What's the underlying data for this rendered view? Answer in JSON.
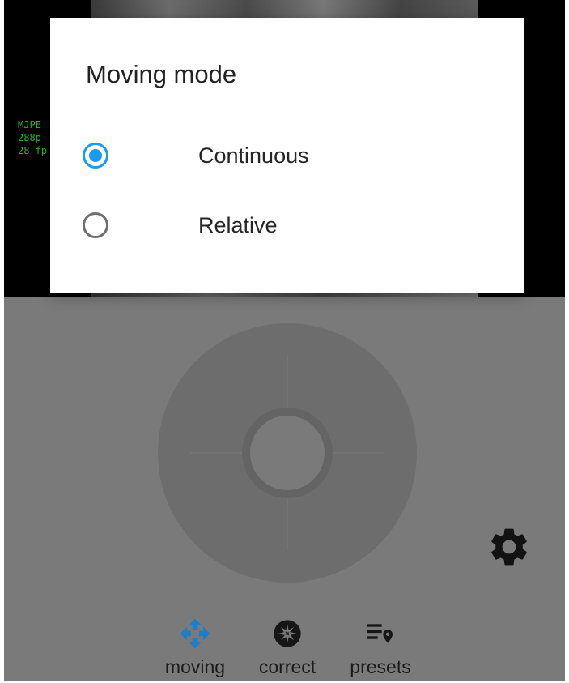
{
  "video_overlay": {
    "line1": "MJPE",
    "line2": "288p",
    "line3": "28 fp"
  },
  "dialog": {
    "title": "Moving mode",
    "options": [
      {
        "label": "Continuous",
        "selected": true
      },
      {
        "label": "Relative",
        "selected": false
      }
    ]
  },
  "bottom_nav": {
    "items": [
      {
        "label": "moving",
        "icon": "move-arrows-icon",
        "active": true
      },
      {
        "label": "correct",
        "icon": "aperture-icon",
        "active": false
      },
      {
        "label": "presets",
        "icon": "list-pin-icon",
        "active": false
      }
    ]
  },
  "settings": {
    "icon": "gear-icon"
  },
  "colors": {
    "accent": "#1a9bef",
    "controls_background": "#7a7a7a",
    "dialog_background": "#ffffff"
  }
}
